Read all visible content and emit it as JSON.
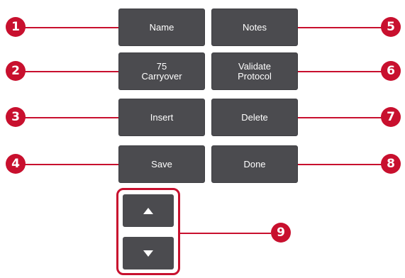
{
  "buttons": {
    "name": "Name",
    "carryover_value": "75",
    "carryover_label": "Carryover",
    "insert": "Insert",
    "save": "Save",
    "notes": "Notes",
    "validate_line1": "Validate",
    "validate_line2": "Protocol",
    "delete": "Delete",
    "done": "Done"
  },
  "callouts": [
    "1",
    "2",
    "3",
    "4",
    "5",
    "6",
    "7",
    "8",
    "9"
  ],
  "colors": {
    "button_bg": "#4b4b4f",
    "callout": "#c8102e"
  },
  "icons": {
    "scroll_up": "triangle-up-icon",
    "scroll_down": "triangle-down-icon"
  }
}
